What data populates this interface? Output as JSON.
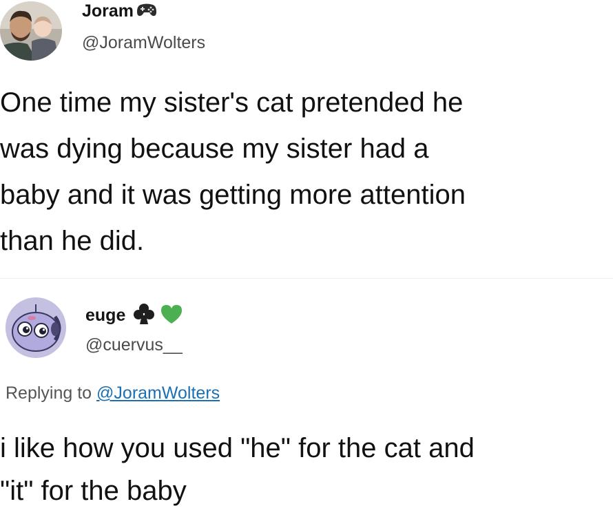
{
  "tweets": [
    {
      "display_name": "Joram",
      "name_emoji": "gamepad-icon",
      "handle": "@JoramWolters",
      "avatar": "father-and-baby-avatar",
      "lines": [
        "One time my sister's cat pretended he",
        "was dying because my sister had a",
        "baby and it was getting more attention",
        "than he did."
      ]
    },
    {
      "display_name": "euge",
      "name_emoji": [
        "club-suit-icon",
        "green-heart-icon"
      ],
      "handle": "@cuervus__",
      "avatar": "cartoon-creature-avatar",
      "replying_prefix": "Replying to",
      "replying_to": "@JoramWolters",
      "lines": [
        "i like how you used \"he\" for the cat and",
        "\"it\" for the baby"
      ]
    }
  ],
  "colors": {
    "link": "#1b6fb3",
    "heart": "#4caf50",
    "handle": "#4a4a4a"
  }
}
